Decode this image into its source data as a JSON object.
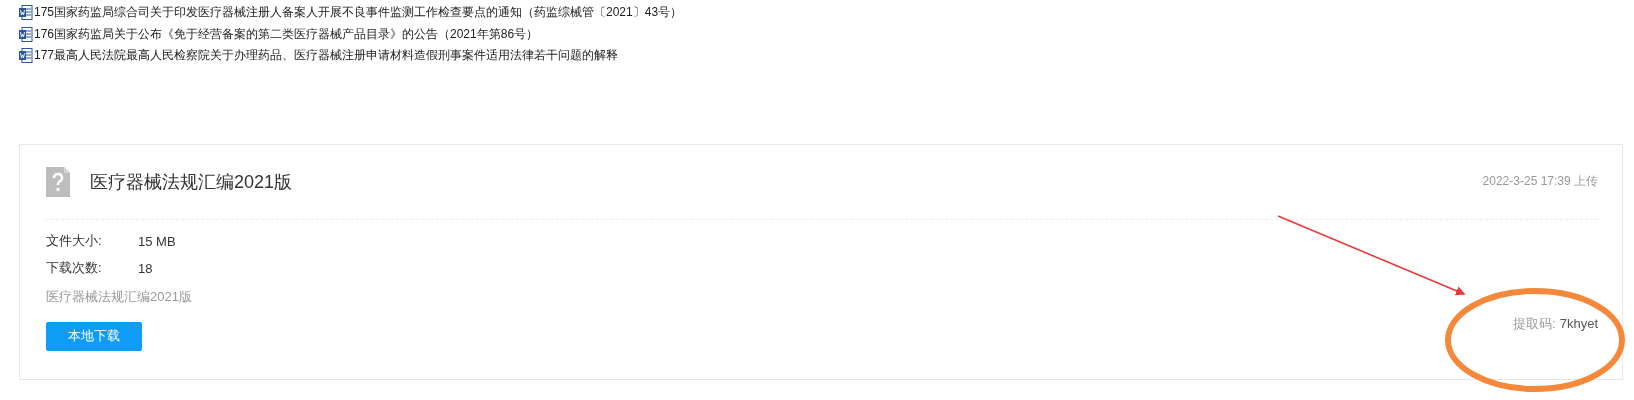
{
  "documents": [
    {
      "title": "175国家药监局综合司关于印发医疗器械注册人备案人开展不良事件监测工作检查要点的通知（药监综械管〔2021〕43号）"
    },
    {
      "title": "176国家药监局关于公布《免于经营备案的第二类医疗器械产品目录》的公告（2021年第86号）"
    },
    {
      "title": "177最高人民法院最高人民检察院关于办理药品、医疗器械注册申请材料造假刑事案件适用法律若干问题的解释"
    }
  ],
  "file_card": {
    "title": "医疗器械法规汇编2021版",
    "uploaded": "2022-3-25 17:39 上传",
    "details": [
      {
        "label": "文件大小:",
        "value": "15 MB"
      },
      {
        "label": "下载次数:",
        "value": "18"
      }
    ],
    "description": "医疗器械法规汇编2021版",
    "download_button": "本地下载",
    "extraction_code": {
      "label": "提取码:",
      "value": "7khyet"
    }
  }
}
